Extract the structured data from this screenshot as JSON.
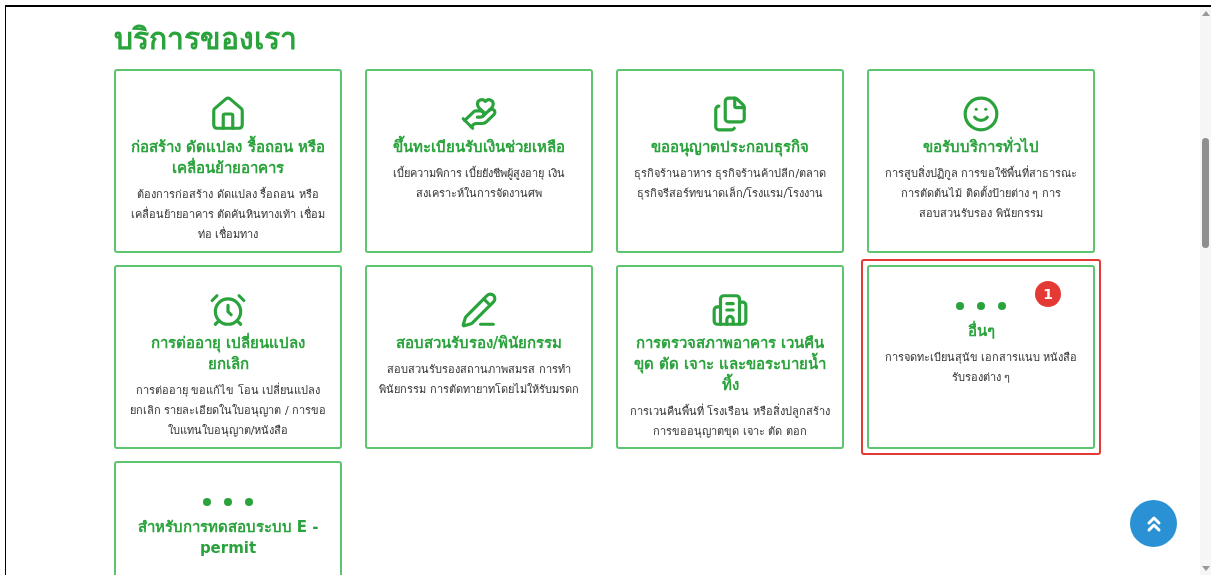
{
  "heading": "บริการของเรา",
  "cards": [
    {
      "title": "ก่อสร้าง ดัดแปลง รื้อถอน หรือเคลื่อนย้ายอาคาร",
      "description": "ต้องการก่อสร้าง ดัดแปลง รื้อถอน หรือเคลื่อนย้ายอาคาร ตัดคันหินทางเท้า เชื่อมท่อ เชื่อมทาง",
      "highlighted": false
    },
    {
      "title": "ขึ้นทะเบียนรับเงินช่วยเหลือ",
      "description": "เบี้ยความพิการ เบี้ยยังชีพผู้สูงอายุ เงินสงเคราะห์ในการจัดงานศพ",
      "highlighted": false
    },
    {
      "title": "ขออนุญาตประกอบธุรกิจ",
      "description": "ธุรกิจร้านอาหาร ธุรกิจร้านค้าปลีก/ตลาด ธุรกิจรีสอร์ทขนาดเล็ก/โรงแรม/โรงงาน",
      "highlighted": false
    },
    {
      "title": "ขอรับบริการทั่วไป",
      "description": "การสูบสิ่งปฏิกูล การขอใช้พื้นที่สาธารณะ การตัดต้นไม้ ติดตั้งป้ายต่าง ๆ การสอบสวนรับรอง พินัยกรรม",
      "highlighted": false
    },
    {
      "title": "การต่ออายุ เปลี่ยนแปลง ยกเลิก",
      "description": "การต่ออายุ ขอแก้ไข โอน เปลี่ยนแปลง ยกเลิก รายละเอียดในใบอนุญาต / การขอใบแทนใบอนุญาต/หนังสือ",
      "highlighted": false
    },
    {
      "title": "สอบสวนรับรอง/พินัยกรรม",
      "description": "สอบสวนรับรองสถานภาพสมรส การทำพินัยกรรม การตัดทายาทโดยไม่ให้รับมรดก",
      "highlighted": false
    },
    {
      "title": "การตรวจสภาพอาคาร เวนคืน ขุด ตัด เจาะ และขอระบายน้ำทิ้ง",
      "description": "การเวนคืนพื้นที่ โรงเรือน หรือสิ่งปลูกสร้าง การขออนุญาตขุด เจาะ ตัด ตอก",
      "highlighted": false
    },
    {
      "title": "อื่นๆ",
      "description": "การจดทะเบียนสุนัข เอกสารแนบ หนังสือรับรองต่าง ๆ",
      "highlighted": true,
      "badge": "1"
    },
    {
      "title": "สำหรับการทดสอบระบบ E - permit",
      "highlighted": false
    }
  ]
}
